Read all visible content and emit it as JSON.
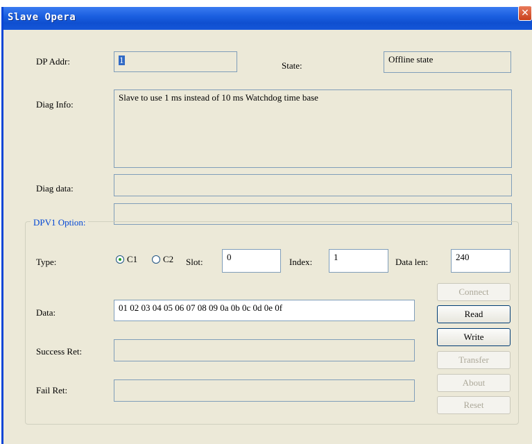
{
  "window": {
    "title": "Slave Opera"
  },
  "labels": {
    "dp_addr": "DP Addr:",
    "state": "State:",
    "diag_info": "Diag Info:",
    "diag_data": "Diag data:",
    "dpv1_option": "DPV1 Option:",
    "type": "Type:",
    "c1": "C1",
    "c2": "C2",
    "slot": "Slot:",
    "index": "Index:",
    "data_len": "Data len:",
    "data": "Data:",
    "success_ret": "Success Ret:",
    "fail_ret": "Fail Ret:"
  },
  "values": {
    "dp_addr": "1",
    "state": "Offline state",
    "diag_info": "Slave to use 1 ms instead of 10 ms Watchdog time base",
    "diag_data_1": "",
    "diag_data_2": "",
    "slot": "0",
    "index": "1",
    "data_len": "240",
    "data": "01 02 03 04 05 06 07 08 09 0a 0b 0c 0d 0e 0f",
    "success_ret": "",
    "fail_ret": "",
    "selected_type": "C1"
  },
  "buttons": {
    "connect": "Connect",
    "read": "Read",
    "write": "Write",
    "transfer": "Transfer",
    "about": "About",
    "reset": "Reset"
  },
  "icons": {
    "close": "close-icon"
  },
  "colors": {
    "titlebar": "#1b5fe0",
    "group_title": "#0046d5",
    "radio_checked": "#21a121"
  }
}
